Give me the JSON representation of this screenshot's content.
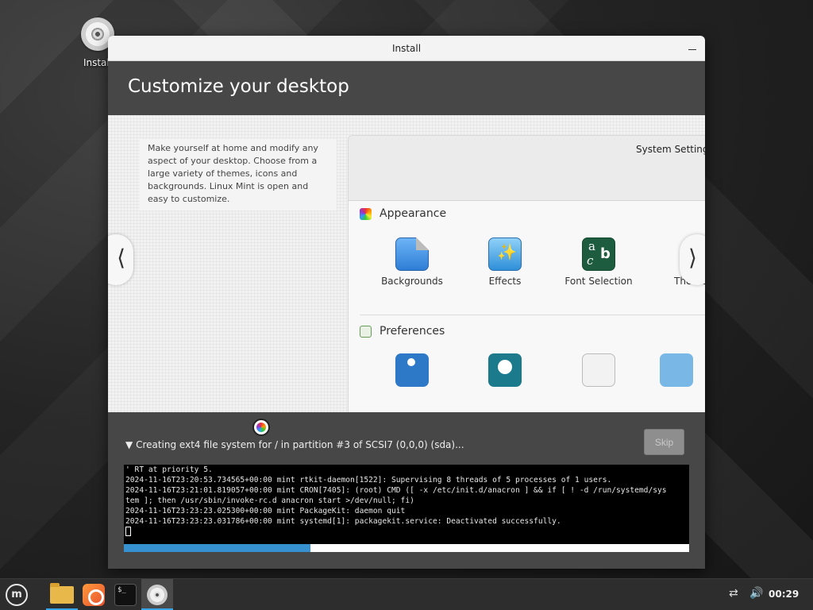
{
  "desktop": {
    "icon_label": "Install"
  },
  "window": {
    "title": "Install",
    "heading": "Customize your desktop"
  },
  "slide": {
    "description": "Make yourself at home and modify any aspect of your desktop. Choose from a large variety of themes, icons and backgrounds. Linux Mint is open and easy to customize.",
    "prev_glyph": "⟨",
    "next_glyph": "⟩",
    "settings_window": {
      "title": "System Settings",
      "sections": [
        {
          "label": "Appearance",
          "icon": "appearance-icon",
          "items": [
            {
              "label": "Backgrounds",
              "icon": "backgrounds-icon"
            },
            {
              "label": "Effects",
              "icon": "effects-icon"
            },
            {
              "label": "Font Selection",
              "icon": "font-selection-icon"
            },
            {
              "label": "Themes",
              "icon": "themes-icon"
            }
          ]
        },
        {
          "label": "Preferences",
          "icon": "preferences-icon"
        }
      ]
    }
  },
  "progress": {
    "status": "Creating ext4 file system for / in partition #3 of SCSI7 (0,0,0) (sda)...",
    "skip_label": "Skip",
    "fraction": 0.33,
    "log_lines": [
      "' RT at priority 5.",
      "2024-11-16T23:20:53.734565+00:00 mint rtkit-daemon[1522]: Supervising 8 threads of 5 processes of 1 users.",
      "2024-11-16T23:21:01.819057+00:00 mint CRON[7405]: (root) CMD ([ -x /etc/init.d/anacron ] && if [ ! -d /run/systemd/sys",
      "tem ]; then /usr/sbin/invoke-rc.d anacron start >/dev/null; fi)",
      "2024-11-16T23:23:23.025300+00:00 mint PackageKit: daemon quit",
      "2024-11-16T23:23:23.031786+00:00 mint systemd[1]: packagekit.service: Deactivated successfully."
    ]
  },
  "taskbar": {
    "terminal_icon_text": "$_",
    "clock": "00:29"
  },
  "colors": {
    "accent": "#35a5e8",
    "progress": "#3790d0",
    "window_bg": "#474747"
  }
}
